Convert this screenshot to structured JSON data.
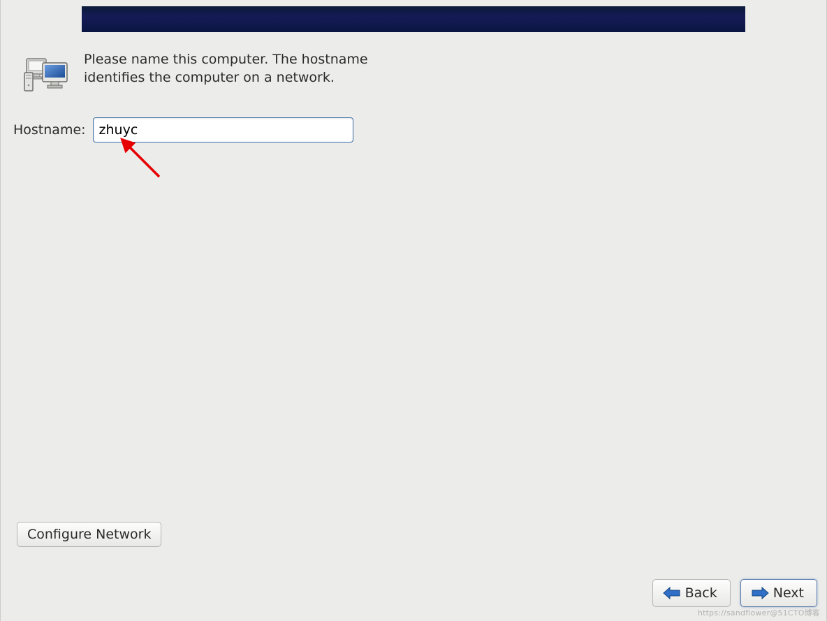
{
  "header": {
    "description": "Please name this computer.  The hostname identifies the computer on a network."
  },
  "form": {
    "hostname_label": "Hostname:",
    "hostname_value": "zhuyc"
  },
  "buttons": {
    "configure_network": "Configure Network",
    "back": "Back",
    "next": "Next"
  },
  "watermark": "https://sandflower@51CTO博客"
}
